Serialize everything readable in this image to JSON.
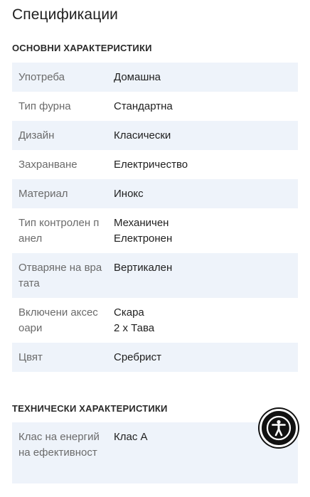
{
  "page": {
    "title": "Спецификации"
  },
  "sections": [
    {
      "title": "ОСНОВНИ ХАРАКТЕРИСТИКИ",
      "rows": [
        {
          "label": "Употреба",
          "values": [
            "Домашна"
          ]
        },
        {
          "label": "Тип фурна",
          "values": [
            "Стандартна"
          ]
        },
        {
          "label": "Дизайн",
          "values": [
            "Класически"
          ]
        },
        {
          "label": "Захранване",
          "values": [
            "Електричество"
          ]
        },
        {
          "label": "Материал",
          "values": [
            "Инокс"
          ]
        },
        {
          "label": "Тип контролен панел",
          "values": [
            "Механичен",
            "Електронен"
          ]
        },
        {
          "label": "Отваряне на вратата",
          "values": [
            "Вертикален"
          ]
        },
        {
          "label": "Включени аксесоари",
          "values": [
            "Скара",
            "2 x Тава"
          ]
        },
        {
          "label": "Цвят",
          "values": [
            "Сребрист"
          ]
        }
      ]
    },
    {
      "title": "ТЕХНИЧЕСКИ ХАРАКТЕРИСТИКИ",
      "rows": [
        {
          "label": "Клас на енергийна ефективност",
          "values": [
            "Клас А"
          ]
        }
      ]
    }
  ],
  "accessibility": {
    "icon": "accessibility-icon"
  },
  "colors": {
    "row_alt": "#eef3fa",
    "label": "#6b6b6b",
    "text": "#1f1f1f",
    "button": "#111111"
  }
}
